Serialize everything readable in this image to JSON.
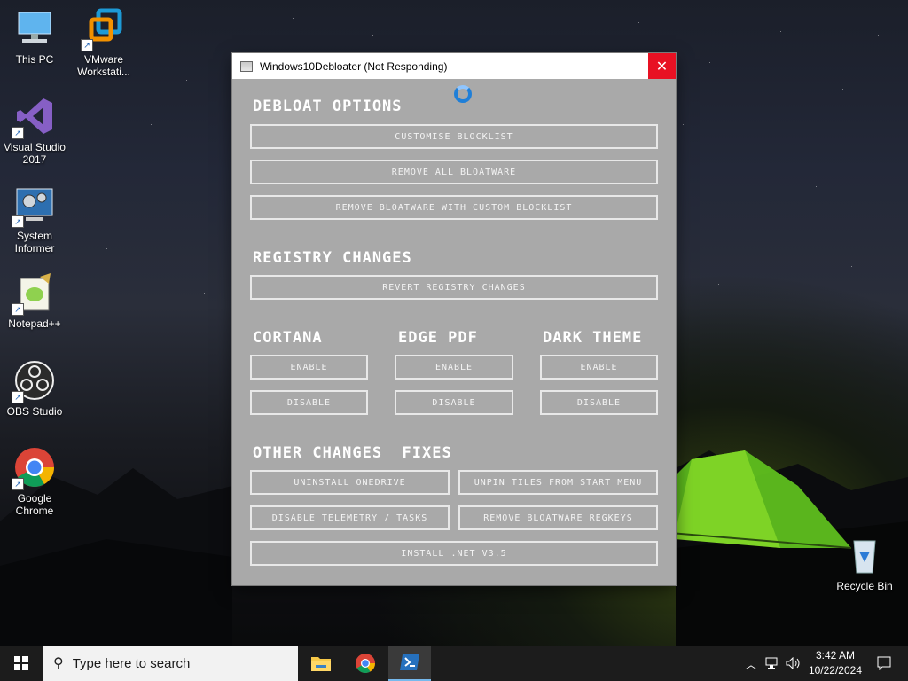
{
  "desktop": {
    "icons": [
      {
        "label": "This PC"
      },
      {
        "label": "VMware Workstati..."
      },
      {
        "label": "Visual Studio 2017"
      },
      {
        "label": "System Informer"
      },
      {
        "label": "Notepad++"
      },
      {
        "label": "OBS Studio"
      },
      {
        "label": "Google Chrome"
      },
      {
        "label": "Recycle Bin"
      }
    ]
  },
  "window": {
    "title": "Windows10Debloater (Not Responding)",
    "close_glyph": "✕",
    "sections": {
      "debloat": "DEBLOAT OPTIONS",
      "registry": "REGISTRY CHANGES",
      "cortana": "CORTANA",
      "edge_pdf": "EDGE PDF",
      "dark_theme": "DARK THEME",
      "other": "OTHER CHANGES  FIXES"
    },
    "buttons": {
      "customise_blocklist": "CUSTOMISE BLOCKLIST",
      "remove_all_bloatware": "REMOVE ALL BLOATWARE",
      "remove_custom": "REMOVE BLOATWARE WITH CUSTOM BLOCKLIST",
      "revert_registry": "REVERT REGISTRY CHANGES",
      "cortana_enable": "ENABLE",
      "cortana_disable": "DISABLE",
      "edge_enable": "ENABLE",
      "edge_disable": "DISABLE",
      "dark_enable": "ENABLE",
      "dark_disable": "DISABLE",
      "uninstall_onedrive": "UNINSTALL ONEDRIVE",
      "unpin_tiles": "UNPIN TILES FROM START MENU",
      "disable_telemetry": "DISABLE TELEMETRY / TASKS",
      "remove_regkeys": "REMOVE BLOATWARE REGKEYS",
      "install_net": "INSTALL .NET V3.5"
    }
  },
  "taskbar": {
    "search_placeholder": "Type here to search",
    "time": "3:42 AM",
    "date": "10/22/2024",
    "apps": [
      "file-explorer-icon",
      "chrome-icon",
      "powershell-icon"
    ]
  },
  "colors": {
    "close_red": "#e81123",
    "window_bg": "#a9a9a9",
    "taskbar_bg": "#1c1c1c",
    "active_app": "#3a3a3a"
  }
}
